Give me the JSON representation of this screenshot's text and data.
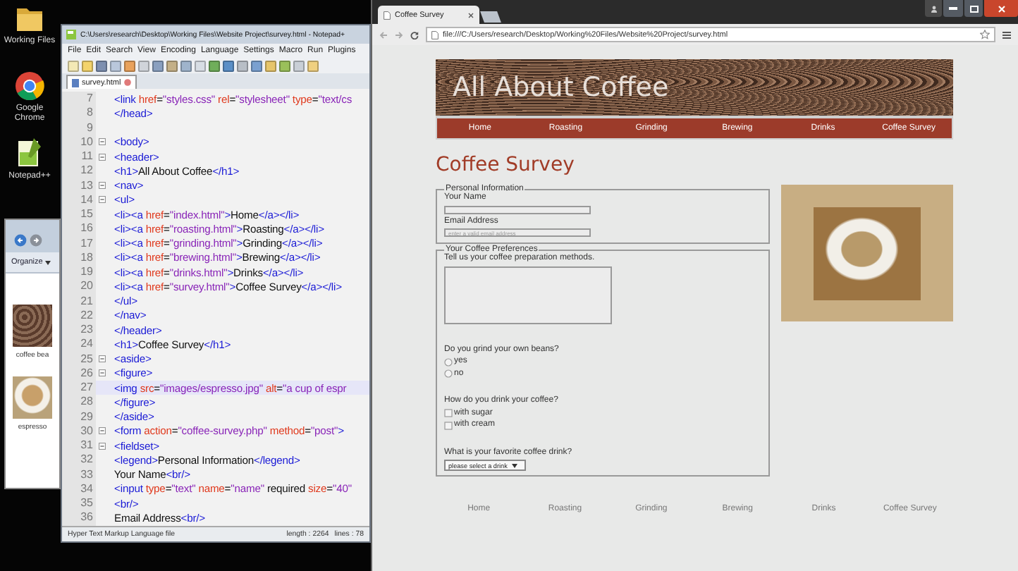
{
  "desktop_icons": [
    {
      "label": "Working Files",
      "kind": "folder"
    },
    {
      "label": "Google Chrome",
      "kind": "chrome"
    },
    {
      "label": "Notepad++",
      "kind": "notepad"
    }
  ],
  "explorer": {
    "organize": "Organize",
    "files": [
      {
        "name": "coffee bea",
        "kind": "beans"
      },
      {
        "name": "espresso",
        "kind": "cup"
      }
    ]
  },
  "editor": {
    "title": "C:\\Users\\research\\Desktop\\Working Files\\Website Project\\survey.html - Notepad+",
    "menu": [
      "File",
      "Edit",
      "Search",
      "View",
      "Encoding",
      "Language",
      "Settings",
      "Macro",
      "Run",
      "Plugins"
    ],
    "tab": "survey.html",
    "lines": [
      {
        "number": "7",
        "fold": false,
        "current": false,
        "tokens": [
          {
            "kind": "tag",
            "text": "<link"
          },
          {
            "kind": "attr",
            "text": " href"
          },
          {
            "kind": "txt",
            "text": "="
          },
          {
            "kind": "val",
            "text": "\"styles.css\""
          },
          {
            "kind": "attr",
            "text": " rel"
          },
          {
            "kind": "txt",
            "text": "="
          },
          {
            "kind": "val",
            "text": "\"stylesheet\""
          },
          {
            "kind": "attr",
            "text": " type"
          },
          {
            "kind": "txt",
            "text": "="
          },
          {
            "kind": "val",
            "text": "\"text/cs"
          }
        ]
      },
      {
        "number": "8",
        "fold": false,
        "current": false,
        "tokens": [
          {
            "kind": "tag",
            "text": "</head>"
          }
        ]
      },
      {
        "number": "9",
        "fold": false,
        "current": false
      },
      {
        "number": "10",
        "fold": true,
        "current": false,
        "tokens": [
          {
            "kind": "tag",
            "text": "<body>"
          }
        ]
      },
      {
        "number": "11",
        "fold": true,
        "current": false,
        "tokens": [
          {
            "kind": "tag",
            "text": "<header>"
          }
        ]
      },
      {
        "number": "12",
        "fold": false,
        "current": false,
        "tokens": [
          {
            "kind": "tag",
            "text": "<h1>"
          },
          {
            "kind": "txt",
            "text": "All About Coffee"
          },
          {
            "kind": "tag",
            "text": "</h1>"
          }
        ]
      },
      {
        "number": "13",
        "fold": true,
        "current": false,
        "tokens": [
          {
            "kind": "tag",
            "text": "<nav>"
          }
        ]
      },
      {
        "number": "14",
        "fold": true,
        "current": false,
        "tokens": [
          {
            "kind": "tag",
            "text": "<ul>"
          }
        ]
      },
      {
        "number": "15",
        "fold": false,
        "current": false,
        "tokens": [
          {
            "kind": "tag",
            "text": "<li><a"
          },
          {
            "kind": "attr",
            "text": " href"
          },
          {
            "kind": "txt",
            "text": "="
          },
          {
            "kind": "val",
            "text": "\"index.html\""
          },
          {
            "kind": "tag",
            "text": ">"
          },
          {
            "kind": "txt",
            "text": "Home"
          },
          {
            "kind": "tag",
            "text": "</a></li>"
          }
        ]
      },
      {
        "number": "16",
        "fold": false,
        "current": false,
        "tokens": [
          {
            "kind": "tag",
            "text": "<li><a"
          },
          {
            "kind": "attr",
            "text": " href"
          },
          {
            "kind": "txt",
            "text": "="
          },
          {
            "kind": "val",
            "text": "\"roasting.html\""
          },
          {
            "kind": "tag",
            "text": ">"
          },
          {
            "kind": "txt",
            "text": "Roasting"
          },
          {
            "kind": "tag",
            "text": "</a></li>"
          }
        ]
      },
      {
        "number": "17",
        "fold": false,
        "current": false,
        "tokens": [
          {
            "kind": "tag",
            "text": "<li><a"
          },
          {
            "kind": "attr",
            "text": " href"
          },
          {
            "kind": "txt",
            "text": "="
          },
          {
            "kind": "val",
            "text": "\"grinding.html\""
          },
          {
            "kind": "tag",
            "text": ">"
          },
          {
            "kind": "txt",
            "text": "Grinding"
          },
          {
            "kind": "tag",
            "text": "</a></li>"
          }
        ]
      },
      {
        "number": "18",
        "fold": false,
        "current": false,
        "tokens": [
          {
            "kind": "tag",
            "text": "<li><a"
          },
          {
            "kind": "attr",
            "text": " href"
          },
          {
            "kind": "txt",
            "text": "="
          },
          {
            "kind": "val",
            "text": "\"brewing.html\""
          },
          {
            "kind": "tag",
            "text": ">"
          },
          {
            "kind": "txt",
            "text": "Brewing"
          },
          {
            "kind": "tag",
            "text": "</a></li>"
          }
        ]
      },
      {
        "number": "19",
        "fold": false,
        "current": false,
        "tokens": [
          {
            "kind": "tag",
            "text": "<li><a"
          },
          {
            "kind": "attr",
            "text": " href"
          },
          {
            "kind": "txt",
            "text": "="
          },
          {
            "kind": "val",
            "text": "\"drinks.html\""
          },
          {
            "kind": "tag",
            "text": ">"
          },
          {
            "kind": "txt",
            "text": "Drinks"
          },
          {
            "kind": "tag",
            "text": "</a></li>"
          }
        ]
      },
      {
        "number": "20",
        "fold": false,
        "current": false,
        "tokens": [
          {
            "kind": "tag",
            "text": "<li><a"
          },
          {
            "kind": "attr",
            "text": " href"
          },
          {
            "kind": "txt",
            "text": "="
          },
          {
            "kind": "val",
            "text": "\"survey.html\""
          },
          {
            "kind": "tag",
            "text": ">"
          },
          {
            "kind": "txt",
            "text": "Coffee Survey"
          },
          {
            "kind": "tag",
            "text": "</a></li>"
          }
        ]
      },
      {
        "number": "21",
        "fold": false,
        "current": false,
        "tokens": [
          {
            "kind": "tag",
            "text": "</ul>"
          }
        ]
      },
      {
        "number": "22",
        "fold": false,
        "current": false,
        "tokens": [
          {
            "kind": "tag",
            "text": "</nav>"
          }
        ]
      },
      {
        "number": "23",
        "fold": false,
        "current": false,
        "tokens": [
          {
            "kind": "tag",
            "text": "</header>"
          }
        ]
      },
      {
        "number": "24",
        "fold": false,
        "current": false,
        "tokens": [
          {
            "kind": "tag",
            "text": "<h1>"
          },
          {
            "kind": "txt",
            "text": "Coffee Survey"
          },
          {
            "kind": "tag",
            "text": "</h1>"
          }
        ]
      },
      {
        "number": "25",
        "fold": true,
        "current": false,
        "tokens": [
          {
            "kind": "tag",
            "text": "<aside>"
          }
        ]
      },
      {
        "number": "26",
        "fold": true,
        "current": false,
        "tokens": [
          {
            "kind": "tag",
            "text": "<figure>"
          }
        ]
      },
      {
        "number": "27",
        "fold": false,
        "current": true,
        "tokens": [
          {
            "kind": "tag",
            "text": "<img"
          },
          {
            "kind": "attr",
            "text": " src"
          },
          {
            "kind": "txt",
            "text": "="
          },
          {
            "kind": "val",
            "text": "\"images/espresso.jpg\""
          },
          {
            "kind": "attr",
            "text": " alt"
          },
          {
            "kind": "txt",
            "text": "="
          },
          {
            "kind": "val",
            "text": "\"a cup of espr"
          }
        ]
      },
      {
        "number": "28",
        "fold": false,
        "current": false,
        "tokens": [
          {
            "kind": "tag",
            "text": "</figure>"
          }
        ]
      },
      {
        "number": "29",
        "fold": false,
        "current": false,
        "tokens": [
          {
            "kind": "tag",
            "text": "</aside>"
          }
        ]
      },
      {
        "number": "30",
        "fold": true,
        "current": false,
        "tokens": [
          {
            "kind": "tag",
            "text": "<form"
          },
          {
            "kind": "attr",
            "text": " action"
          },
          {
            "kind": "txt",
            "text": "="
          },
          {
            "kind": "val",
            "text": "\"coffee-survey.php\""
          },
          {
            "kind": "attr",
            "text": " method"
          },
          {
            "kind": "txt",
            "text": "="
          },
          {
            "kind": "val",
            "text": "\"post\""
          },
          {
            "kind": "tag",
            "text": ">"
          }
        ]
      },
      {
        "number": "31",
        "fold": true,
        "current": false,
        "tokens": [
          {
            "kind": "tag",
            "text": "<fieldset>"
          }
        ]
      },
      {
        "number": "32",
        "fold": false,
        "current": false,
        "tokens": [
          {
            "kind": "tag",
            "text": "<legend>"
          },
          {
            "kind": "txt",
            "text": "Personal Information"
          },
          {
            "kind": "tag",
            "text": "</legend>"
          }
        ]
      },
      {
        "number": "33",
        "fold": false,
        "current": false,
        "tokens": [
          {
            "kind": "txt",
            "text": "Your Name"
          },
          {
            "kind": "tag",
            "text": "<br/>"
          }
        ]
      },
      {
        "number": "34",
        "fold": false,
        "current": false,
        "tokens": [
          {
            "kind": "tag",
            "text": "<input"
          },
          {
            "kind": "attr",
            "text": " type"
          },
          {
            "kind": "txt",
            "text": "="
          },
          {
            "kind": "val",
            "text": "\"text\""
          },
          {
            "kind": "attr",
            "text": " name"
          },
          {
            "kind": "txt",
            "text": "="
          },
          {
            "kind": "val",
            "text": "\"name\""
          },
          {
            "kind": "txt",
            "text": " required"
          },
          {
            "kind": "attr",
            "text": " size"
          },
          {
            "kind": "txt",
            "text": "="
          },
          {
            "kind": "val",
            "text": "\"40\""
          }
        ]
      },
      {
        "number": "35",
        "fold": false,
        "current": false,
        "tokens": [
          {
            "kind": "tag",
            "text": "<br/>"
          }
        ]
      },
      {
        "number": "36",
        "fold": false,
        "current": false,
        "tokens": [
          {
            "kind": "txt",
            "text": "Email Address"
          },
          {
            "kind": "tag",
            "text": "<br/>"
          }
        ]
      }
    ],
    "status": {
      "file_type": "Hyper Text Markup Language file",
      "length": "length : 2264",
      "lines": "lines : 78"
    }
  },
  "browser": {
    "tab": "Coffee Survey",
    "url": "file:///C:/Users/research/Desktop/Working%20Files/Website%20Project/survey.html",
    "page": {
      "site_title": "All About Coffee",
      "nav": [
        {
          "label": "Home"
        },
        {
          "label": "Roasting"
        },
        {
          "label": "Grinding"
        },
        {
          "label": "Brewing"
        },
        {
          "label": "Drinks"
        },
        {
          "label": "Coffee Survey"
        }
      ],
      "heading": "Coffee Survey",
      "personal": {
        "legend": "Personal Information",
        "name_label": "Your Name",
        "email_label": "Email Address",
        "email_placeholder": "enter a valid email address"
      },
      "preferences": {
        "legend": "Your Coffee Preferences",
        "methods_label": "Tell us your coffee preparation methods.",
        "grind_question": "Do you grind your own beans?",
        "grind_options": [
          {
            "label": "yes",
            "checked": false
          },
          {
            "label": "no",
            "checked": false
          }
        ],
        "drink_question": "How do you drink your coffee?",
        "drink_options": [
          {
            "label": "with sugar",
            "checked": false
          },
          {
            "label": "with cream",
            "checked": false
          }
        ],
        "favorite_question": "What is your favorite coffee drink?",
        "favorite_select": "please select a drink"
      },
      "footer_nav": [
        {
          "label": "Home"
        },
        {
          "label": "Roasting"
        },
        {
          "label": "Grinding"
        },
        {
          "label": "Brewing"
        },
        {
          "label": "Drinks"
        },
        {
          "label": "Coffee Survey"
        }
      ]
    }
  }
}
